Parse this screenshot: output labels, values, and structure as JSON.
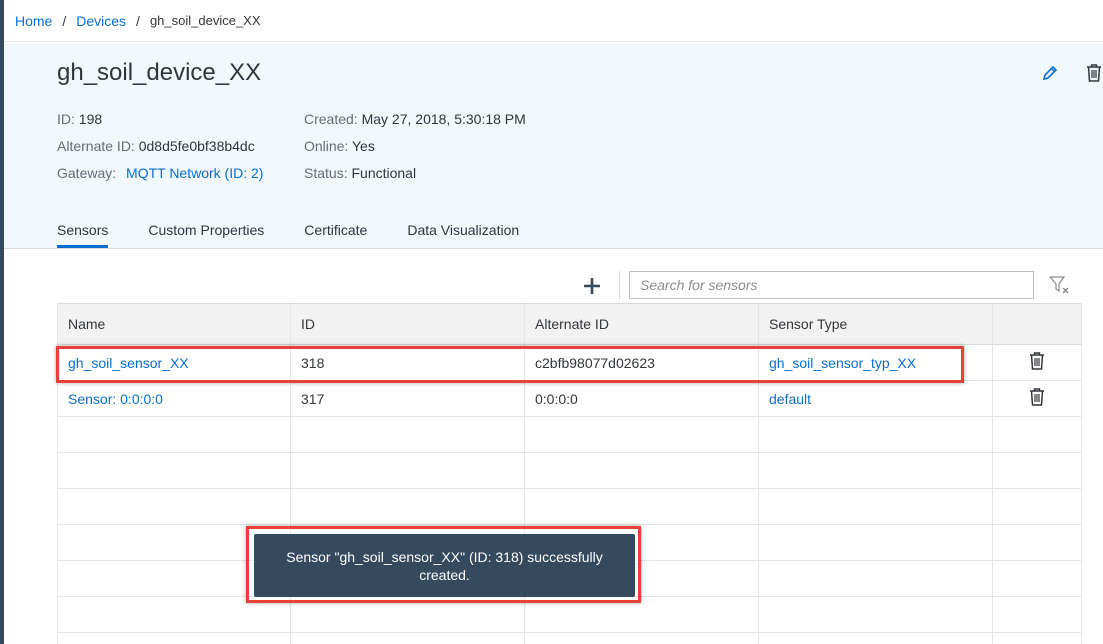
{
  "breadcrumb": {
    "items": [
      "Home",
      "Devices"
    ],
    "current": "gh_soil_device_XX"
  },
  "device": {
    "title": "gh_soil_device_XX",
    "left": [
      {
        "label": "ID:",
        "value": "198"
      },
      {
        "label": "Alternate ID:",
        "value": "0d8d5fe0bf38b4dc"
      },
      {
        "label": "Gateway:",
        "value": "MQTT Network (ID: 2)"
      }
    ],
    "right": [
      {
        "label": "Created:",
        "value": "May 27, 2018, 5:30:18 PM"
      },
      {
        "label": "Online:",
        "value": "Yes"
      },
      {
        "label": "Status:",
        "value": "Functional"
      }
    ]
  },
  "tabs": [
    {
      "label": "Sensors",
      "active": true
    },
    {
      "label": "Custom Properties",
      "active": false
    },
    {
      "label": "Certificate",
      "active": false
    },
    {
      "label": "Data Visualization",
      "active": false
    }
  ],
  "toolbar": {
    "add_icon": "plus-icon",
    "search_placeholder": "Search for sensors",
    "filter_icon": "clear-filter-icon"
  },
  "table": {
    "columns": [
      "Name",
      "ID",
      "Alternate ID",
      "Sensor Type",
      ""
    ],
    "rows": [
      {
        "name": "gh_soil_sensor_XX",
        "id": "318",
        "alternate_id": "c2bfb98077d02623",
        "sensor_type": "gh_soil_sensor_typ_XX"
      },
      {
        "name": "Sensor: 0:0:0:0",
        "id": "317",
        "alternate_id": "0:0:0:0",
        "sensor_type": "default"
      }
    ],
    "empty_rows": 7
  },
  "toast": {
    "message": "Sensor \"gh_soil_sensor_XX\" (ID: 318) successfully created."
  },
  "colors": {
    "accent": "#0a6ed1",
    "header_bg": "#f0f7fd",
    "toast_bg": "#354a5f",
    "highlight": "#e9413a"
  }
}
